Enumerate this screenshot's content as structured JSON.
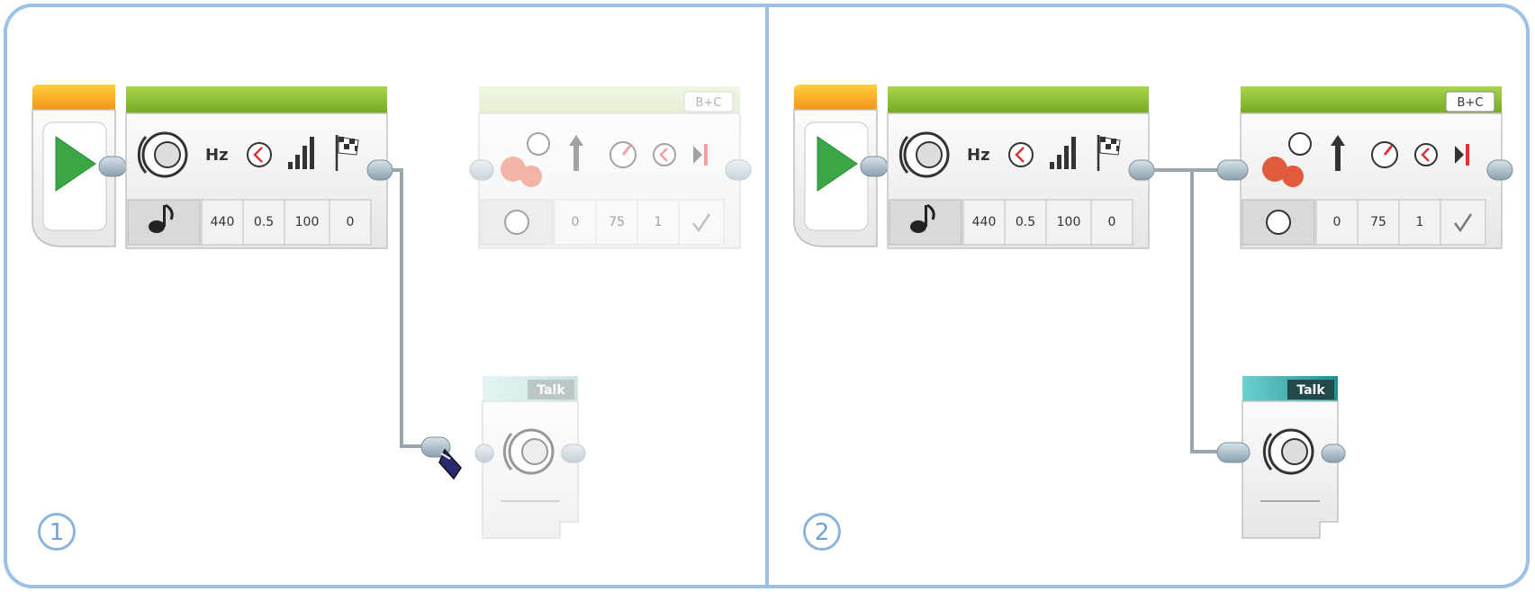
{
  "panels": [
    {
      "number": "1",
      "sound_block": {
        "params": [
          "440",
          "0.5",
          "100",
          "0"
        ],
        "hz_label": "Hz"
      },
      "move_block": {
        "ports": "B+C",
        "params": [
          "0",
          "75",
          "1"
        ],
        "state": "ghost"
      },
      "talk_block": {
        "title": "Talk",
        "state": "ghost"
      }
    },
    {
      "number": "2",
      "sound_block": {
        "params": [
          "440",
          "0.5",
          "100",
          "0"
        ],
        "hz_label": "Hz"
      },
      "move_block": {
        "ports": "B+C",
        "params": [
          "0",
          "75",
          "1"
        ],
        "state": "active"
      },
      "talk_block": {
        "title": "Talk",
        "state": "active"
      }
    }
  ],
  "colors": {
    "frame": "#9dc1e6",
    "start_top": "#f5a623",
    "sound_top": "#8cbd2f",
    "move_top": "#8cbd2f",
    "talk_top": "#2aa6a6",
    "play_green": "#3aa645",
    "motor_red": "#e25a3c"
  }
}
